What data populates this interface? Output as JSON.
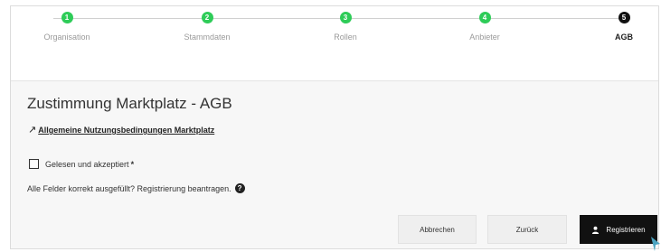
{
  "stepper": {
    "steps": [
      {
        "number": "1",
        "label": "Organisation",
        "state": "done"
      },
      {
        "number": "2",
        "label": "Stammdaten",
        "state": "done"
      },
      {
        "number": "3",
        "label": "Rollen",
        "state": "done"
      },
      {
        "number": "4",
        "label": "Anbieter",
        "state": "done"
      },
      {
        "number": "5",
        "label": "AGB",
        "state": "active"
      }
    ]
  },
  "main": {
    "title": "Zustimmung Marktplatz - AGB",
    "terms_link": "Allgemeine Nutzungsbedingungen Marktplatz",
    "checkbox_label": "Gelesen und akzeptiert",
    "required_marker": "*",
    "hint": "Alle Felder korrekt ausgefüllt? Registrierung beantragen.",
    "help_icon_glyph": "?"
  },
  "actions": {
    "cancel_label": "Abbrechen",
    "back_label": "Zurück",
    "register_label": "Registrieren"
  },
  "colors": {
    "step_done": "#2ecc58",
    "step_active": "#111111",
    "primary_button": "#111111",
    "cursor": "#4aa3c0"
  }
}
